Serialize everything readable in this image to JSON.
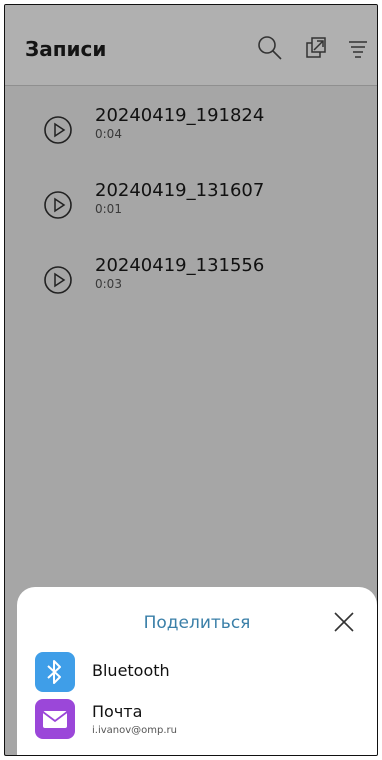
{
  "header": {
    "title": "Записи",
    "icons": [
      "search-icon",
      "share-icon",
      "filter-icon"
    ]
  },
  "recordings": [
    {
      "name": "20240419_191824",
      "duration": "0:04"
    },
    {
      "name": "20240419_131607",
      "duration": "0:01"
    },
    {
      "name": "20240419_131556",
      "duration": "0:03"
    }
  ],
  "share_sheet": {
    "title": "Поделиться",
    "options": [
      {
        "label": "Bluetooth",
        "icon": "bluetooth-icon"
      },
      {
        "label": "Почта",
        "sublabel": "i.ivanov@omp.ru",
        "icon": "mail-icon"
      }
    ]
  },
  "colors": {
    "dim_background": "#a6a6a6",
    "accent": "#3a7fa8",
    "bluetooth": "#3f9ee8",
    "mail": "#9b47d9"
  }
}
